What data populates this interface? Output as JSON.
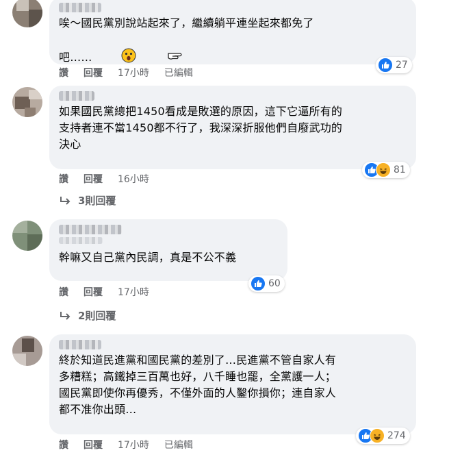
{
  "comments": [
    {
      "text": "唉～國民黨別說站起來了，繼續躺平連坐起來都免了\n吧……",
      "emoji_icons": [
        "surprised-face-icon",
        "pointing-hand-icon"
      ],
      "reaction_count": "27",
      "reactions": [
        "like"
      ],
      "actions": {
        "like": "讚",
        "reply": "回覆",
        "time": "17小時",
        "edited": "已編輯"
      }
    },
    {
      "text": "如果國民黨總把1450看成是敗選的原因，這下它逼所有的\n支持者連不當1450都不行了，我深深折服他們自廢武功的\n決心",
      "reaction_count": "81",
      "reactions": [
        "like",
        "haha"
      ],
      "actions": {
        "like": "讚",
        "reply": "回覆",
        "time": "16小時"
      },
      "replies_label": "3則回覆"
    },
    {
      "text": "幹嘛又自己黨內民調，真是不公不義",
      "reaction_count": "60",
      "reactions": [
        "like"
      ],
      "actions": {
        "like": "讚",
        "reply": "回覆",
        "time": "17小時"
      },
      "replies_label": "2則回覆"
    },
    {
      "text": "終於知道民進黨和國民黨的差別了…民進黨不管自家人有\n多糟糕；高鐵掉三百萬也好，八千睡也罷，全黨護一人；\n國民黨即使你再優秀，不僅外面的人鑿你損你；連自家人\n都不准你出頭…",
      "reaction_count": "274",
      "reactions": [
        "like",
        "haha"
      ],
      "actions": {
        "like": "讚",
        "reply": "回覆",
        "time": "17小時",
        "edited": "已編輯"
      }
    }
  ],
  "colors": {
    "bubble": "#f0f2f5",
    "like": "#1877f2",
    "haha": "#f7b125",
    "meta": "#65676b"
  }
}
